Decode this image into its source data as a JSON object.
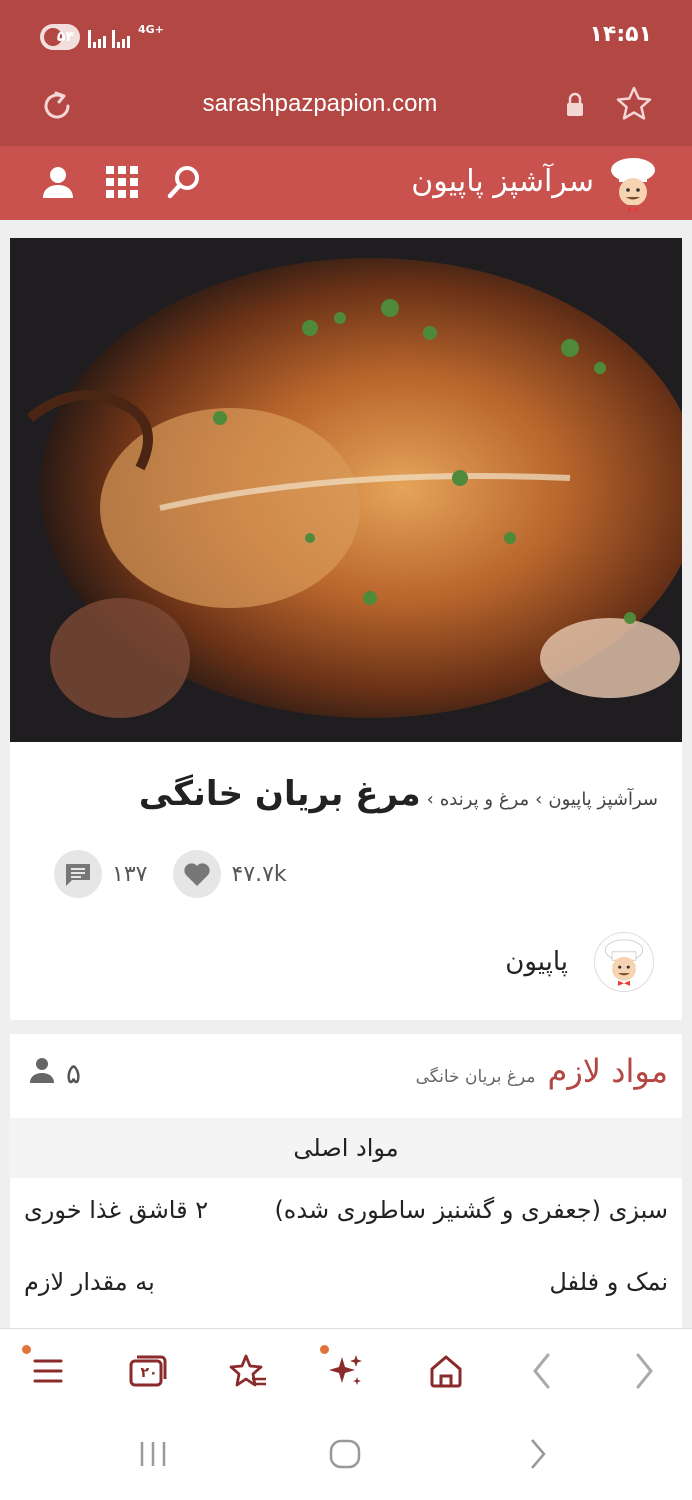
{
  "status_bar": {
    "time": "۱۴:۵۱",
    "battery": "۵۴",
    "network": "4G+"
  },
  "browser": {
    "url": "sarashpazpapion.com"
  },
  "site": {
    "name": "سرآشپز پاپیون"
  },
  "recipe": {
    "breadcrumbs": [
      "سرآشپز پاپیون",
      "مرغ و پرنده"
    ],
    "title": "مرغ بریان خانگی",
    "likes": "۴۷.۷k",
    "comments": "۱۳۷",
    "author": "پاپیون"
  },
  "ingredients": {
    "heading": "مواد لازم",
    "subtitle": "مرغ بریان خانگی",
    "servings": "۵",
    "group": "مواد اصلی",
    "items": [
      {
        "name": "سبزی (جعفری و گشنیز ساطوری شده)",
        "amount": "۲ قاشق غذا خوری"
      },
      {
        "name": "نمک و فلفل",
        "amount": "به مقدار لازم"
      }
    ]
  },
  "tabs_count": "۲۰",
  "colors": {
    "brand": "#b34744",
    "header": "#c9514e",
    "toolbar_icon": "#8a2a2a",
    "badge_dot": "#e0733c"
  }
}
